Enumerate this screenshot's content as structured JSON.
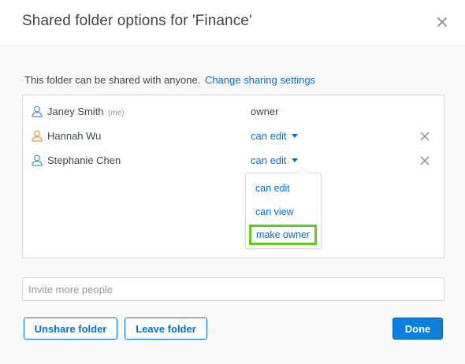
{
  "dialog": {
    "title": "Shared folder options for 'Finance'"
  },
  "sharing": {
    "note": "This folder can be shared with anyone.",
    "change_link": "Change sharing settings"
  },
  "members": [
    {
      "name": "Janey Smith",
      "tag": "(me)",
      "role": "owner",
      "icon_color": "#4a90d9"
    },
    {
      "name": "Hannah Wu",
      "tag": "",
      "role": "can edit",
      "icon_color": "#e8963a"
    },
    {
      "name": "Stephanie Chen",
      "tag": "",
      "role": "can edit",
      "icon_color": "#4a90d9"
    }
  ],
  "role_menu": {
    "items": [
      "can edit",
      "can view",
      "make owner"
    ],
    "highlighted": "make owner",
    "highlight_color": "#62cc1e"
  },
  "invite": {
    "placeholder": "Invite more people"
  },
  "buttons": {
    "unshare": "Unshare folder",
    "leave": "Leave folder",
    "done": "Done"
  },
  "colors": {
    "accent": "#0070e0",
    "primary_button": "#0a7fdb"
  },
  "icons": {
    "close": "close-icon",
    "user": "user-icon",
    "remove": "remove-x-icon",
    "dropdown": "caret-down-icon"
  }
}
